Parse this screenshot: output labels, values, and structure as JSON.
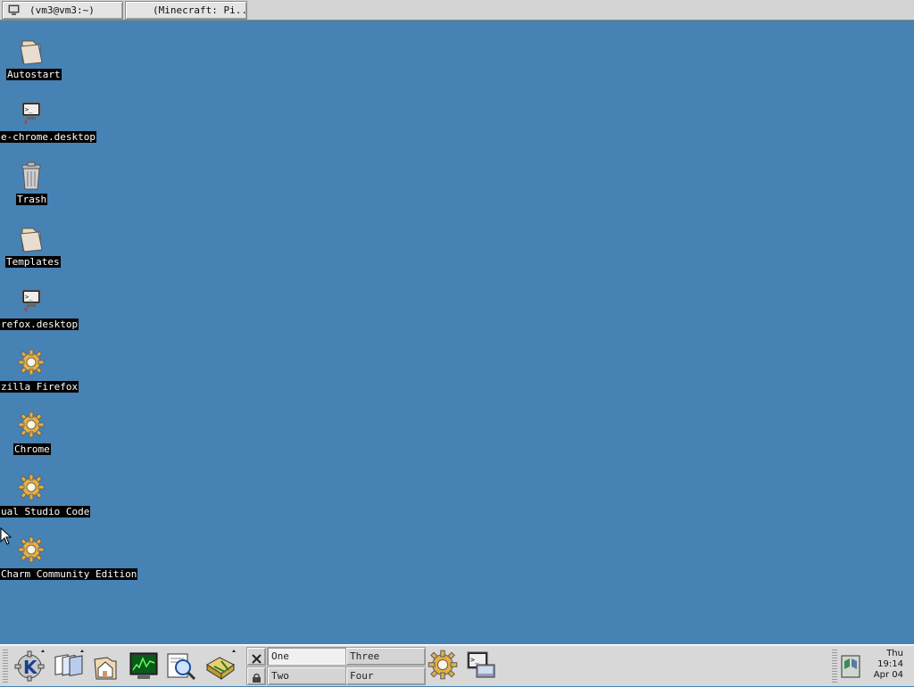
{
  "top_taskbar": {
    "tasks": [
      {
        "label": "(vm3@vm3:~)",
        "icon": "terminal-icon"
      },
      {
        "label": "(Minecraft: Pi...",
        "icon": "none"
      }
    ]
  },
  "desktop": {
    "background_color": "#4682b4",
    "icons": [
      {
        "label": "Autostart",
        "icon": "folder-icon"
      },
      {
        "label": "e-chrome.desktop",
        "icon": "desktop-file-icon"
      },
      {
        "label": "Trash",
        "icon": "trash-icon"
      },
      {
        "label": "Templates",
        "icon": "folder-icon"
      },
      {
        "label": "refox.desktop",
        "icon": "desktop-file-icon"
      },
      {
        "label": "zilla Firefox",
        "icon": "gear-icon"
      },
      {
        "label": "Chrome",
        "icon": "gear-icon"
      },
      {
        "label": "ual Studio Code",
        "icon": "gear-icon"
      },
      {
        "label": "Charm Community Edition",
        "icon": "gear-icon"
      }
    ]
  },
  "panel": {
    "launchers": [
      {
        "icon": "kde-menu-icon"
      },
      {
        "icon": "windows-list-icon"
      },
      {
        "icon": "home-folder-icon"
      },
      {
        "icon": "system-monitor-icon"
      },
      {
        "icon": "find-files-icon"
      },
      {
        "icon": "control-center-icon"
      }
    ],
    "virtual_desktops": [
      {
        "label": "One",
        "active": true
      },
      {
        "label": "Two",
        "active": false
      },
      {
        "label": "Three",
        "active": false
      },
      {
        "label": "Four",
        "active": false
      }
    ],
    "tray_launchers": [
      {
        "icon": "gear-icon"
      },
      {
        "icon": "konsole-icon"
      }
    ],
    "clock": {
      "day": "Thu",
      "time": "19:14",
      "date": "Apr 04"
    }
  }
}
